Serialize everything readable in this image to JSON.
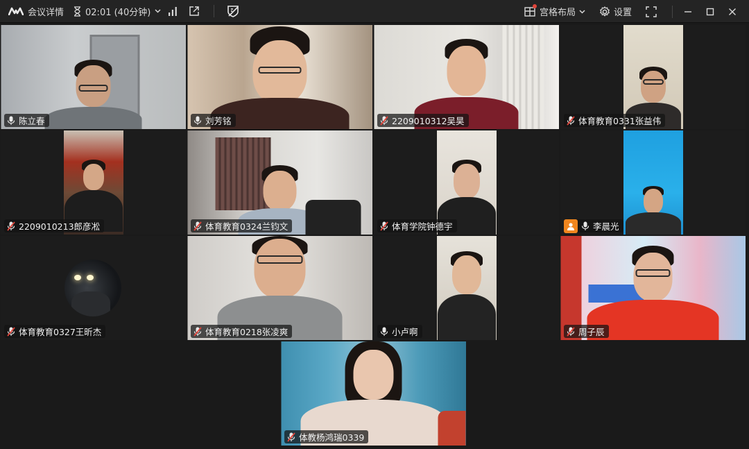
{
  "toolbar": {
    "meeting_details": "会议详情",
    "timer": "02:01 (40分钟)",
    "layout_label": "宫格布局",
    "settings_label": "设置"
  },
  "participants": [
    {
      "name": "陈立春",
      "muted": false
    },
    {
      "name": "刘芳铭",
      "muted": false
    },
    {
      "name": "2209010312吴昊",
      "muted": true
    },
    {
      "name": "体育教育0331张益伟",
      "muted": true
    },
    {
      "name": "2209010213郎彦凇",
      "muted": true
    },
    {
      "name": "体育教育0324兰钧文",
      "muted": true
    },
    {
      "name": "体育学院钟德宇",
      "muted": true
    },
    {
      "name": "李晨光",
      "muted": false
    },
    {
      "name": "体育教育0327王昕杰",
      "muted": true
    },
    {
      "name": "体育教育0218张凌爽",
      "muted": true
    },
    {
      "name": "小卢啊",
      "muted": false
    },
    {
      "name": "周子辰",
      "muted": true
    },
    {
      "name": "体教杨鸿瑞0339",
      "muted": true
    }
  ],
  "colors": {
    "background": "#1a1a1a",
    "toolbar": "#242424",
    "accent_red": "#e0443a",
    "avatar_orange": "#f0861e"
  }
}
